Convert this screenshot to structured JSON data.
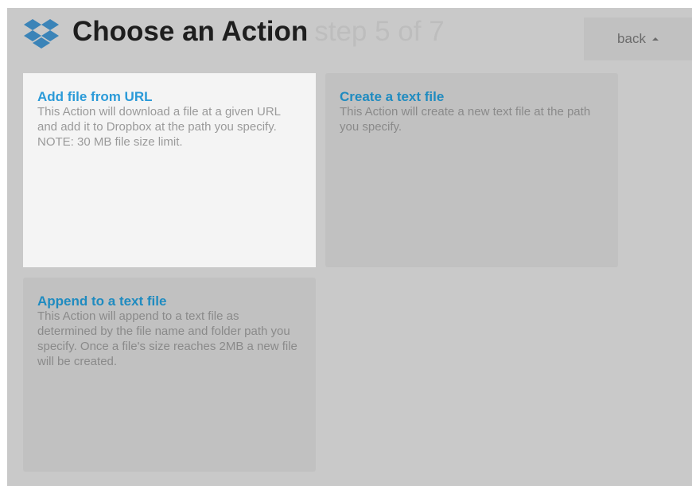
{
  "header": {
    "title": "Choose an Action",
    "step": "step 5 of 7",
    "back_label": "back",
    "logo_icon": "dropbox-logo-icon",
    "caret_icon": "caret-up-icon"
  },
  "cards": [
    {
      "title": "Add file from URL",
      "description": "This Action will download a file at a given URL and add it to Dropbox at the path you specify. NOTE: 30 MB file size limit.",
      "state": "highlighted"
    },
    {
      "title": "Create a text file",
      "description": "This Action will create a new text file at the path you specify.",
      "state": "normal"
    },
    {
      "title": "Append to a text file",
      "description": "This Action will append to a text file as determined by the file name and folder path you specify. Once a file's size reaches 2MB a new file will be created.",
      "state": "normal"
    }
  ],
  "colors": {
    "overlay": "#c9c9c9",
    "card_bg": "#c1c1c1",
    "card_active_bg": "#f4f4f4",
    "link_blue": "#2a9ad8",
    "logo_blue": "#3b84b8"
  }
}
